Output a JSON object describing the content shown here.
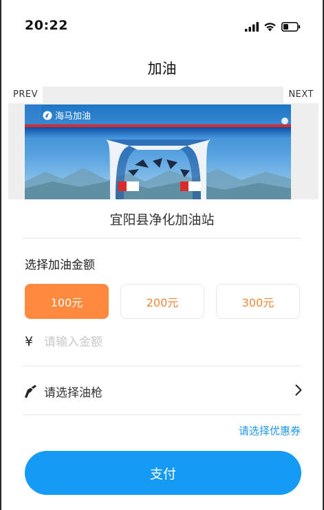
{
  "status_bar": {
    "time": "20:22"
  },
  "header": {
    "title": "加油"
  },
  "carousel": {
    "prev_label": "PREV",
    "next_label": "NEXT",
    "brand_text": "海马加油"
  },
  "station": {
    "name": "宜阳县净化加油站"
  },
  "amount_section": {
    "title": "选择加油金额",
    "options": [
      {
        "label": "100元",
        "selected": true
      },
      {
        "label": "200元",
        "selected": false
      },
      {
        "label": "300元",
        "selected": false
      }
    ],
    "currency_symbol": "¥",
    "input_placeholder": "请输入金额",
    "input_value": ""
  },
  "nozzle": {
    "label": "请选择油枪",
    "icon": "fuel-nozzle-icon"
  },
  "coupon": {
    "label": "请选择优惠券"
  },
  "pay": {
    "label": "支付"
  },
  "colors": {
    "accent_orange": "#ff8a3d",
    "primary_blue": "#169bf4",
    "link_blue": "#1e96e6"
  }
}
